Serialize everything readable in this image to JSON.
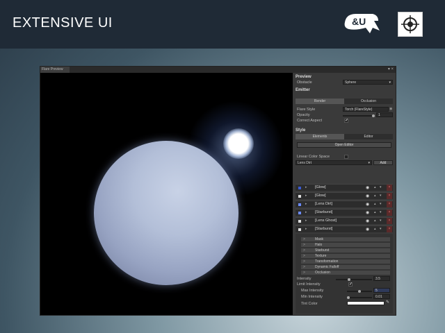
{
  "header": {
    "title": "EXTENSIVE UI",
    "logo_text": "&U",
    "logo_icon": "crosshair-icon"
  },
  "window": {
    "tab_label": "Flare Preview",
    "controls": "▾ ×"
  },
  "inspector": {
    "preview": {
      "heading": "Preview",
      "obstacle_label": "Obstacle",
      "obstacle_value": "Sphere"
    },
    "emitter": {
      "heading": "Emitter",
      "tabs": [
        "Render",
        "Occlusion"
      ],
      "flare_style_label": "Flare Style",
      "flare_style_value": "Torch (FlareStyle)",
      "opacity_label": "Opacity",
      "opacity_value": "1",
      "correct_aspect_label": "Correct Aspect",
      "correct_aspect_checked": "✓"
    },
    "style": {
      "heading": "Style",
      "tabs": [
        "Elements",
        "Editor"
      ],
      "open_editor_label": "Open Editor",
      "linear_color_label": "Linear Color Space",
      "preset_value": "Lens Dirt",
      "add_label": "Add"
    },
    "elements": [
      {
        "name": "[Glow]",
        "square": "#3a5bd1"
      },
      {
        "name": "[Glow]",
        "square": "#dddddd"
      },
      {
        "name": "[Lens Dirt]",
        "square": "#6b8bff"
      },
      {
        "name": "[Starburst]",
        "square": "#6b8bff"
      },
      {
        "name": "[Lens Ghost]",
        "square": "#dddddd"
      },
      {
        "name": "[Starburst]",
        "square": "#dddddd"
      }
    ],
    "subsections": [
      "Mask",
      "Halo",
      "Starburst",
      "Texture",
      "Transformation",
      "Dynamic Falloff",
      "Occlusion"
    ],
    "properties": {
      "intensity_label": "Intensity",
      "intensity_value": "3.5",
      "intensity_level": 0.35,
      "limit_intensity_label": "Limit Intensity",
      "limit_intensity_checked": "✓",
      "max_intensity_label": "Max Intensity",
      "max_intensity_value": "5",
      "max_intensity_level": 0.5,
      "min_intensity_label": "Min Intensity",
      "min_intensity_value": "0.01",
      "min_intensity_level": 0.0,
      "tint_color_label": "Tint Color",
      "tint_color": "#ffffff"
    }
  }
}
